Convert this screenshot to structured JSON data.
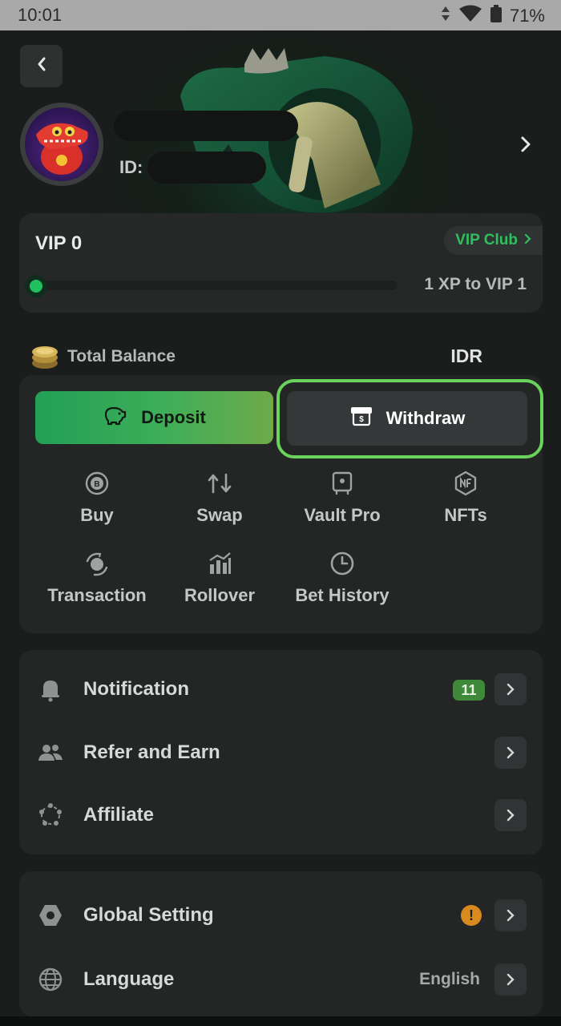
{
  "status_bar": {
    "time": "10:01",
    "battery": "71%"
  },
  "profile": {
    "id_label": "ID:"
  },
  "vip": {
    "level": "VIP 0",
    "club_label": "VIP Club",
    "xp_text": "1 XP to VIP 1",
    "progress": 0.0
  },
  "balance": {
    "label": "Total Balance",
    "currency": "IDR"
  },
  "actions": {
    "deposit": "Deposit",
    "withdraw": "Withdraw"
  },
  "shortcuts": [
    {
      "label": "Buy",
      "icon": "bitcoin-coin-icon"
    },
    {
      "label": "Swap",
      "icon": "swap-arrows-icon"
    },
    {
      "label": "Vault Pro",
      "icon": "vault-icon"
    },
    {
      "label": "NFTs",
      "icon": "nft-icon"
    },
    {
      "label": "Transaction",
      "icon": "transaction-icon"
    },
    {
      "label": "Rollover",
      "icon": "bar-chart-icon"
    },
    {
      "label": "Bet History",
      "icon": "clock-icon"
    }
  ],
  "menu_section_1": [
    {
      "label": "Notification",
      "badge": "11"
    },
    {
      "label": "Refer and Earn"
    },
    {
      "label": "Affiliate"
    }
  ],
  "menu_section_2": [
    {
      "label": "Global Setting",
      "alert": "!"
    },
    {
      "label": "Language",
      "value": "English"
    }
  ],
  "colors": {
    "accent_green": "#21c05e",
    "highlight_ring": "#69d35c",
    "background": "#1b1c1c",
    "card": "#242626",
    "warning": "#d98a1f"
  }
}
